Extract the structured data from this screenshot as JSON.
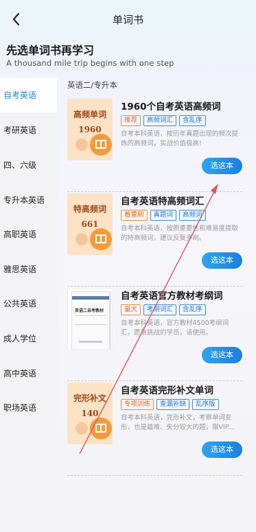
{
  "header": {
    "title": "单词书",
    "back_icon": "chevron-left-icon"
  },
  "hero": {
    "title": "先选单词书再学习",
    "subtitle": "A thousand mile trip begins with one step"
  },
  "sidebar": {
    "items": [
      {
        "label": "自考英语",
        "active": true
      },
      {
        "label": "考研英语"
      },
      {
        "label": "四、六级"
      },
      {
        "label": "专升本英语"
      },
      {
        "label": "高职英语"
      },
      {
        "label": "雅思英语"
      },
      {
        "label": "公共英语"
      },
      {
        "label": "成人学位"
      },
      {
        "label": "高中英语"
      },
      {
        "label": "职场英语"
      }
    ]
  },
  "main": {
    "section_label": "英语二/专升本",
    "books": [
      {
        "cover_line1": "高频单词",
        "cover_line2": "1960",
        "title": "1960个自考英语高频词",
        "tags": [
          "推荐",
          "高频词汇",
          "含乱序"
        ],
        "description": "自考本科英语，按历年真题出现的频次提炼的高频词，实战价值极高!",
        "button": "选这本"
      },
      {
        "cover_line1": "特高频词",
        "cover_line2": "661",
        "title": "自考英语特高频词汇",
        "tags": [
          "着重刷",
          "真题词",
          "高频词"
        ],
        "description": "自考本科英语，按照重要性和难易度提取的特高频词，建议反复多刷。",
        "button": "选这本"
      },
      {
        "cover_title": "英语二自考教材",
        "title": "自考英语官方教材考纲词",
        "tags": [
          "量大",
          "考纲词汇",
          "含乱序"
        ],
        "description": "自考本科英语，官方教材4500考纲词汇，愿意挑战的学员，请使用。",
        "button": "选这本"
      },
      {
        "cover_line1": "完形补文",
        "cover_line2": "140",
        "title": "自考英语完形补文单词",
        "tags": [
          "专项训练",
          "查漏补缺",
          "乱序版"
        ],
        "description": "自考本科英语，完形补文，考察单词变形，也是最难、失分较大的题，限VIP...",
        "button": "选这本"
      }
    ]
  },
  "colors": {
    "accent": "#1e87d6",
    "button": "#1b7fe0",
    "warm_tag": "#f08b3c",
    "annotation_arrow": "#e0555a"
  }
}
